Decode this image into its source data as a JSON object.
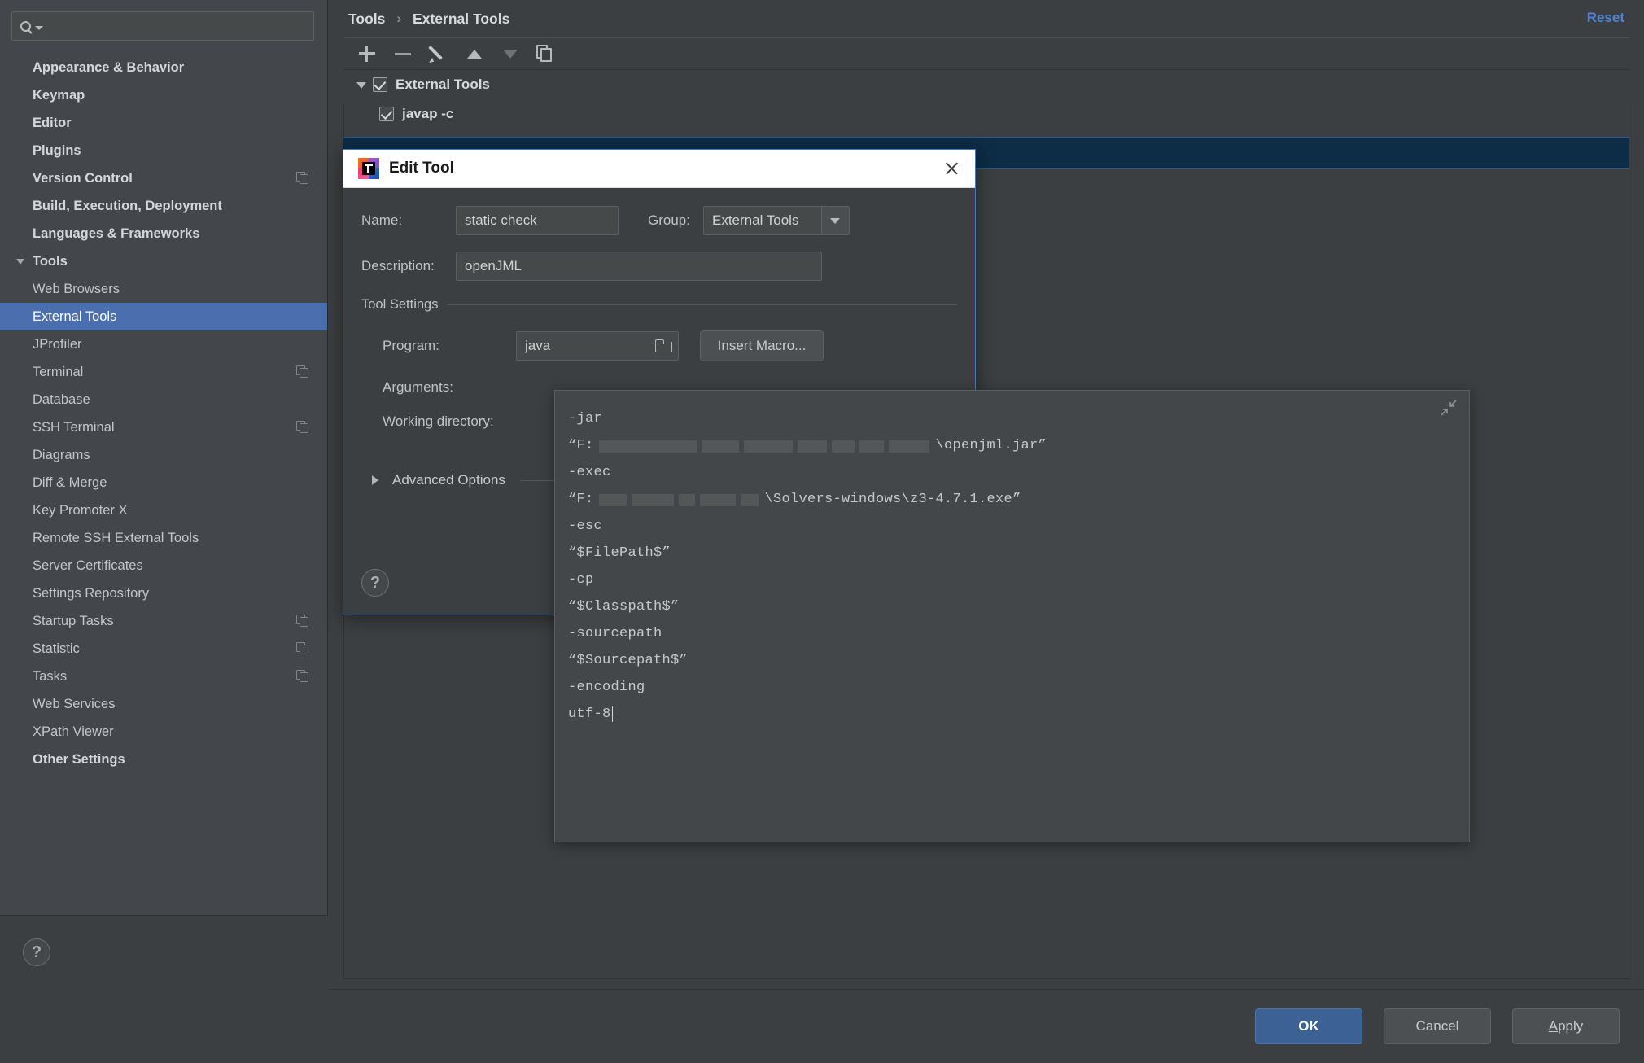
{
  "search": {
    "placeholder": "",
    "value": "",
    "icon": "search-icon"
  },
  "sidebar": {
    "items": [
      {
        "label": "Appearance & Behavior",
        "arrow": "right",
        "level": 0,
        "bold": true,
        "copy": false,
        "selected": false
      },
      {
        "label": "Keymap",
        "arrow": "none",
        "level": 0,
        "bold": true,
        "copy": false,
        "selected": false
      },
      {
        "label": "Editor",
        "arrow": "right",
        "level": 0,
        "bold": true,
        "copy": false,
        "selected": false
      },
      {
        "label": "Plugins",
        "arrow": "none",
        "level": 0,
        "bold": true,
        "copy": false,
        "selected": false
      },
      {
        "label": "Version Control",
        "arrow": "right",
        "level": 0,
        "bold": true,
        "copy": true,
        "selected": false
      },
      {
        "label": "Build, Execution, Deployment",
        "arrow": "right",
        "level": 0,
        "bold": true,
        "copy": false,
        "selected": false
      },
      {
        "label": "Languages & Frameworks",
        "arrow": "right",
        "level": 0,
        "bold": true,
        "copy": false,
        "selected": false
      },
      {
        "label": "Tools",
        "arrow": "down",
        "level": 0,
        "bold": true,
        "copy": false,
        "selected": false
      },
      {
        "label": "Web Browsers",
        "arrow": "none",
        "level": 1,
        "bold": false,
        "copy": false,
        "selected": false
      },
      {
        "label": "External Tools",
        "arrow": "none",
        "level": 1,
        "bold": false,
        "copy": false,
        "selected": true
      },
      {
        "label": "JProfiler",
        "arrow": "none",
        "level": 1,
        "bold": false,
        "copy": false,
        "selected": false
      },
      {
        "label": "Terminal",
        "arrow": "none",
        "level": 1,
        "bold": false,
        "copy": true,
        "selected": false
      },
      {
        "label": "Database",
        "arrow": "right",
        "level": 1,
        "bold": false,
        "copy": false,
        "selected": false
      },
      {
        "label": "SSH Terminal",
        "arrow": "none",
        "level": 1,
        "bold": false,
        "copy": true,
        "selected": false
      },
      {
        "label": "Diagrams",
        "arrow": "none",
        "level": 1,
        "bold": false,
        "copy": false,
        "selected": false
      },
      {
        "label": "Diff & Merge",
        "arrow": "right",
        "level": 1,
        "bold": false,
        "copy": false,
        "selected": false
      },
      {
        "label": "Key Promoter X",
        "arrow": "none",
        "level": 1,
        "bold": false,
        "copy": false,
        "selected": false
      },
      {
        "label": "Remote SSH External Tools",
        "arrow": "none",
        "level": 1,
        "bold": false,
        "copy": false,
        "selected": false
      },
      {
        "label": "Server Certificates",
        "arrow": "none",
        "level": 1,
        "bold": false,
        "copy": false,
        "selected": false
      },
      {
        "label": "Settings Repository",
        "arrow": "none",
        "level": 1,
        "bold": false,
        "copy": false,
        "selected": false
      },
      {
        "label": "Startup Tasks",
        "arrow": "none",
        "level": 1,
        "bold": false,
        "copy": true,
        "selected": false
      },
      {
        "label": "Statistic",
        "arrow": "none",
        "level": 1,
        "bold": false,
        "copy": true,
        "selected": false
      },
      {
        "label": "Tasks",
        "arrow": "right",
        "level": 1,
        "bold": false,
        "copy": true,
        "selected": false
      },
      {
        "label": "Web Services",
        "arrow": "none",
        "level": 1,
        "bold": false,
        "copy": false,
        "selected": false
      },
      {
        "label": "XPath Viewer",
        "arrow": "none",
        "level": 1,
        "bold": false,
        "copy": false,
        "selected": false
      },
      {
        "label": "Other Settings",
        "arrow": "right",
        "level": 0,
        "bold": true,
        "copy": false,
        "selected": false
      }
    ],
    "help_label": "?"
  },
  "breadcrumb": {
    "parent": "Tools",
    "separator": "›",
    "current": "External Tools"
  },
  "header": {
    "reset_label": "Reset"
  },
  "toolbar": {
    "buttons": [
      {
        "name": "add-tool-button",
        "icon": "plus-icon",
        "enabled": true
      },
      {
        "name": "remove-tool-button",
        "icon": "minus-icon",
        "enabled": false
      },
      {
        "name": "edit-tool-button",
        "icon": "pencil-icon",
        "enabled": true
      },
      {
        "name": "move-up-button",
        "icon": "arrow-up-icon",
        "enabled": true
      },
      {
        "name": "move-down-button",
        "icon": "arrow-down-icon",
        "enabled": false
      },
      {
        "name": "copy-tool-button",
        "icon": "copy-icon",
        "enabled": true
      }
    ]
  },
  "tools_tree": {
    "group": {
      "label": "External Tools",
      "checked": true,
      "expanded": true
    },
    "children": [
      {
        "label": "javap -c",
        "checked": true
      }
    ]
  },
  "dialog": {
    "title": "Edit Tool",
    "icon": "intellij-logo-icon",
    "close_icon": "close-icon",
    "name_label": "Name:",
    "name_value": "static check",
    "group_label": "Group:",
    "group_value": "External Tools",
    "description_label": "Description:",
    "description_value": "openJML",
    "tool_settings_legend": "Tool Settings",
    "program_label": "Program:",
    "program_value": "java",
    "browse_icon": "folder-icon",
    "insert_macro_label": "Insert Macro...",
    "arguments_label": "Arguments:",
    "working_directory_label": "Working directory:",
    "advanced_options_label": "Advanced Options",
    "help_label": "?"
  },
  "arguments_popup": {
    "collapse_icon": "collapse-icon",
    "lines": [
      {
        "text": "-jar"
      },
      {
        "prefix": "“F:",
        "redacted": [
          120,
          46,
          60,
          36,
          28,
          30,
          50
        ],
        "suffix": "\\openjml.jar”"
      },
      {
        "text": "-exec"
      },
      {
        "prefix": "“F:",
        "redacted": [
          34,
          52,
          20,
          44,
          22
        ],
        "suffix": "\\Solvers-windows\\z3-4.7.1.exe”"
      },
      {
        "text": "-esc"
      },
      {
        "text": "“$FilePath$”"
      },
      {
        "text": "-cp"
      },
      {
        "text": "“$Classpath$”"
      },
      {
        "text": "-sourcepath"
      },
      {
        "text": "“$Sourcepath$”"
      },
      {
        "text": "-encoding"
      },
      {
        "text": "utf-8",
        "caret": true
      }
    ]
  },
  "footer": {
    "ok_label": "OK",
    "cancel_label": "Cancel",
    "apply_label": "Apply",
    "apply_mnemonic": "A"
  },
  "colors": {
    "background": "#3c3f41",
    "sidebar": "#43464a",
    "accent_selection": "#4b6eaf",
    "row_selection_dark": "#0d2c46",
    "link": "#4d84d6",
    "primary_button": "#3c6295",
    "dialog_border": "#4a7ab5",
    "text": "#c3c6c9"
  }
}
